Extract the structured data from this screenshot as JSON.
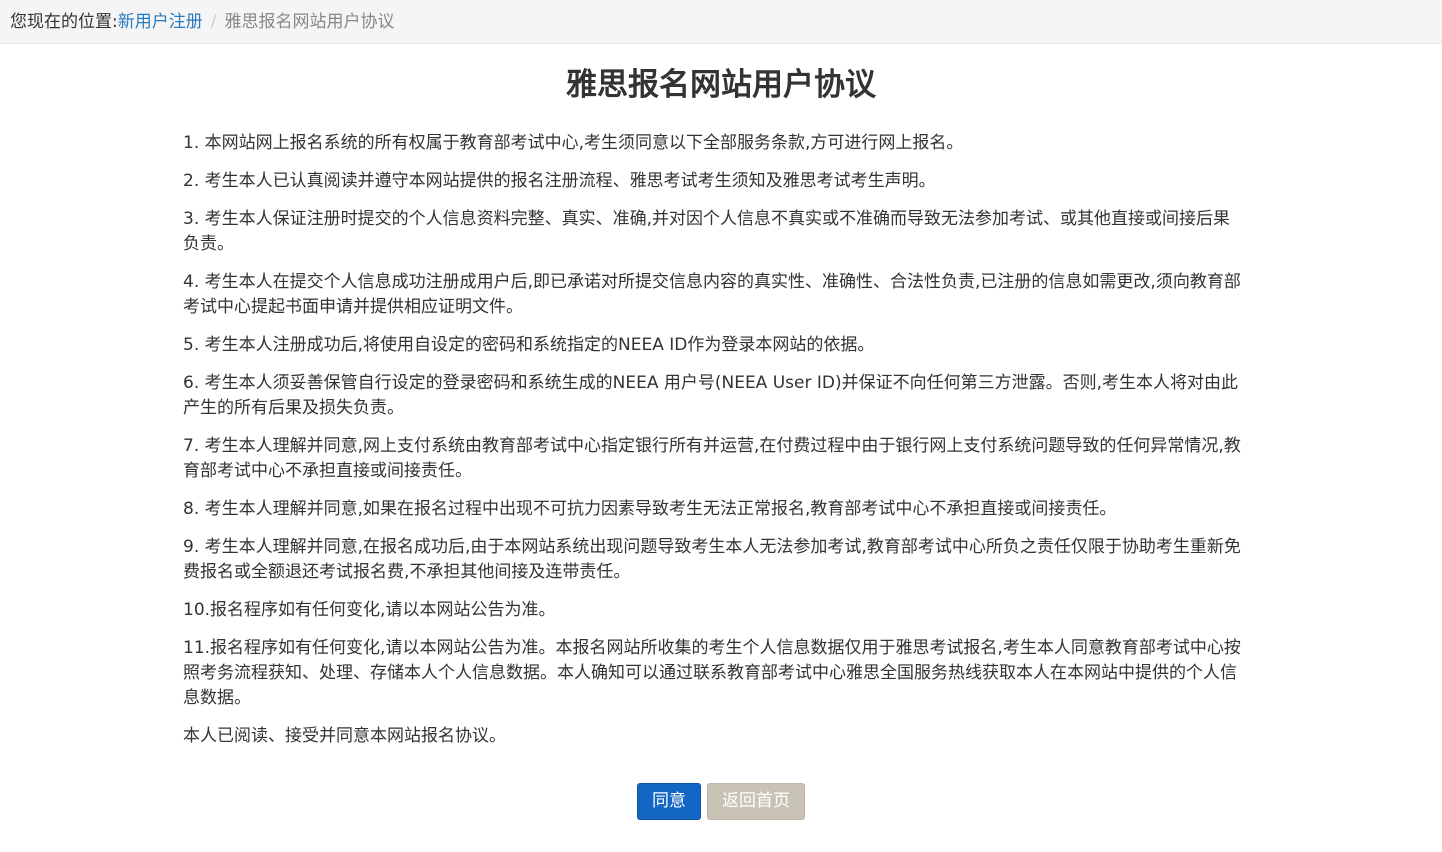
{
  "breadcrumb": {
    "prefix": "您现在的位置:",
    "link": "新用户注册",
    "separator": "/",
    "current": "雅思报名网站用户协议"
  },
  "page": {
    "title": "雅思报名网站用户协议"
  },
  "clauses": [
    "1. 本网站网上报名系统的所有权属于教育部考试中心,考生须同意以下全部服务条款,方可进行网上报名。",
    "2. 考生本人已认真阅读并遵守本网站提供的报名注册流程、雅思考试考生须知及雅思考试考生声明。",
    "3. 考生本人保证注册时提交的个人信息资料完整、真实、准确,并对因个人信息不真实或不准确而导致无法参加考试、或其他直接或间接后果负责。",
    "4. 考生本人在提交个人信息成功注册成用户后,即已承诺对所提交信息内容的真实性、准确性、合法性负责,已注册的信息如需更改,须向教育部考试中心提起书面申请并提供相应证明文件。",
    "5. 考生本人注册成功后,将使用自设定的密码和系统指定的NEEA ID作为登录本网站的依据。",
    "6. 考生本人须妥善保管自行设定的登录密码和系统生成的NEEA 用户号(NEEA User ID)并保证不向任何第三方泄露。否则,考生本人将对由此产生的所有后果及损失负责。",
    "7. 考生本人理解并同意,网上支付系统由教育部考试中心指定银行所有并运营,在付费过程中由于银行网上支付系统问题导致的任何异常情况,教育部考试中心不承担直接或间接责任。",
    "8. 考生本人理解并同意,如果在报名过程中出现不可抗力因素导致考生无法正常报名,教育部考试中心不承担直接或间接责任。",
    "9. 考生本人理解并同意,在报名成功后,由于本网站系统出现问题导致考生本人无法参加考试,教育部考试中心所负之责任仅限于协助考生重新免费报名或全额退还考试报名费,不承担其他间接及连带责任。",
    "10.报名程序如有任何变化,请以本网站公告为准。",
    "11.报名程序如有任何变化,请以本网站公告为准。本报名网站所收集的考生个人信息数据仅用于雅思考试报名,考生本人同意教育部考试中心按照考务流程获知、处理、存储本人个人信息数据。本人确知可以通过联系教育部考试中心雅思全国服务热线获取本人在本网站中提供的个人信息数据。",
    "本人已阅读、接受并同意本网站报名协议。"
  ],
  "actions": {
    "agree_label": "同意",
    "back_label": "返回首页"
  },
  "colors": {
    "link": "#2a7ac0",
    "primary_button": "#1466c4",
    "secondary_button": "#c9c3b6",
    "breadcrumb_bg": "#f5f5f5"
  }
}
